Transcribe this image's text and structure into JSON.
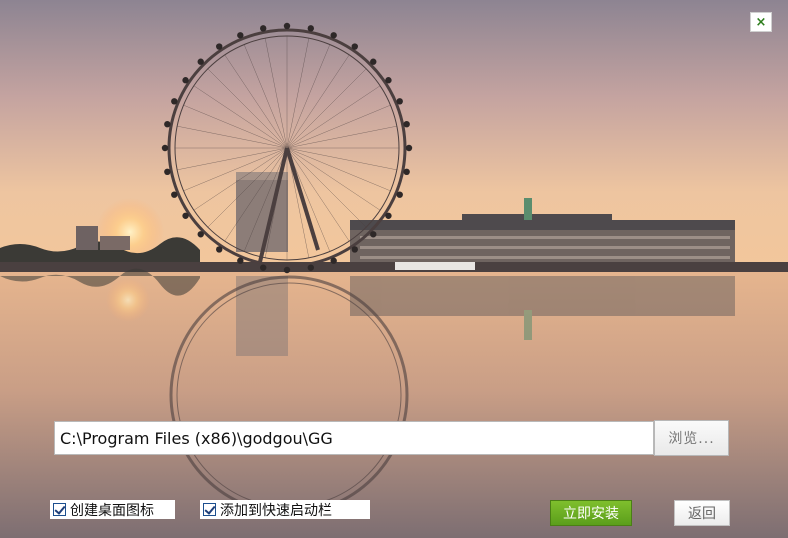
{
  "window": {
    "close_icon_glyph": "×",
    "background_image": "london-eye-sunrise-reflection"
  },
  "install": {
    "path_value": "C:\\Program Files (x86)\\godgou\\GG",
    "browse_label": "浏览...",
    "create_desktop_icon": {
      "label": "创建桌面图标",
      "checked": true
    },
    "add_quick_launch": {
      "label": "添加到快速启动栏",
      "checked": true
    },
    "install_label": "立即安装",
    "back_label": "返回"
  },
  "colors": {
    "accent_green": "#6aae24",
    "close_x": "#2e7d1d",
    "checkbox_border": "#1c4f8f"
  }
}
